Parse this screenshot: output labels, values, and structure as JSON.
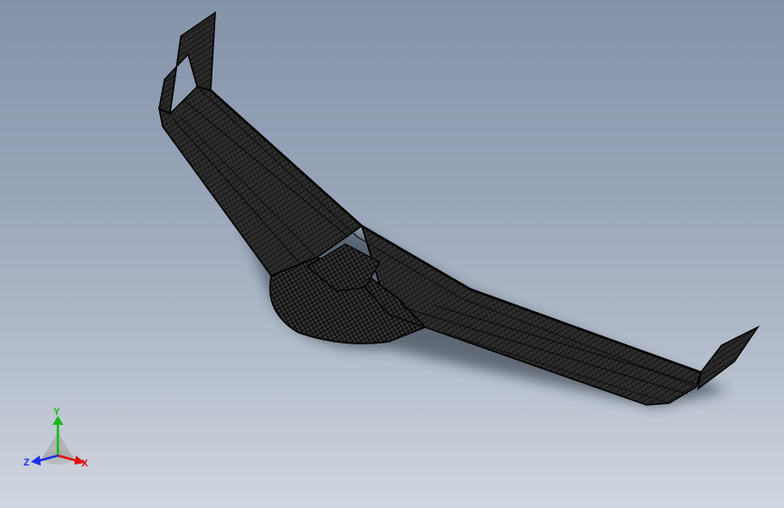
{
  "viewport": {
    "background_top": "#8593a9",
    "background_bottom": "#d0d6df",
    "model": {
      "name": "flying-wing-mesh",
      "render_style": "wireframe",
      "mesh_color": "#0a0a0a",
      "body_color": "#3a3a3a"
    }
  },
  "triad": {
    "x_label": "X",
    "y_label": "Y",
    "z_label": "Z",
    "x_color": "#e01010",
    "y_color": "#18b818",
    "z_color": "#1a2fe8"
  }
}
